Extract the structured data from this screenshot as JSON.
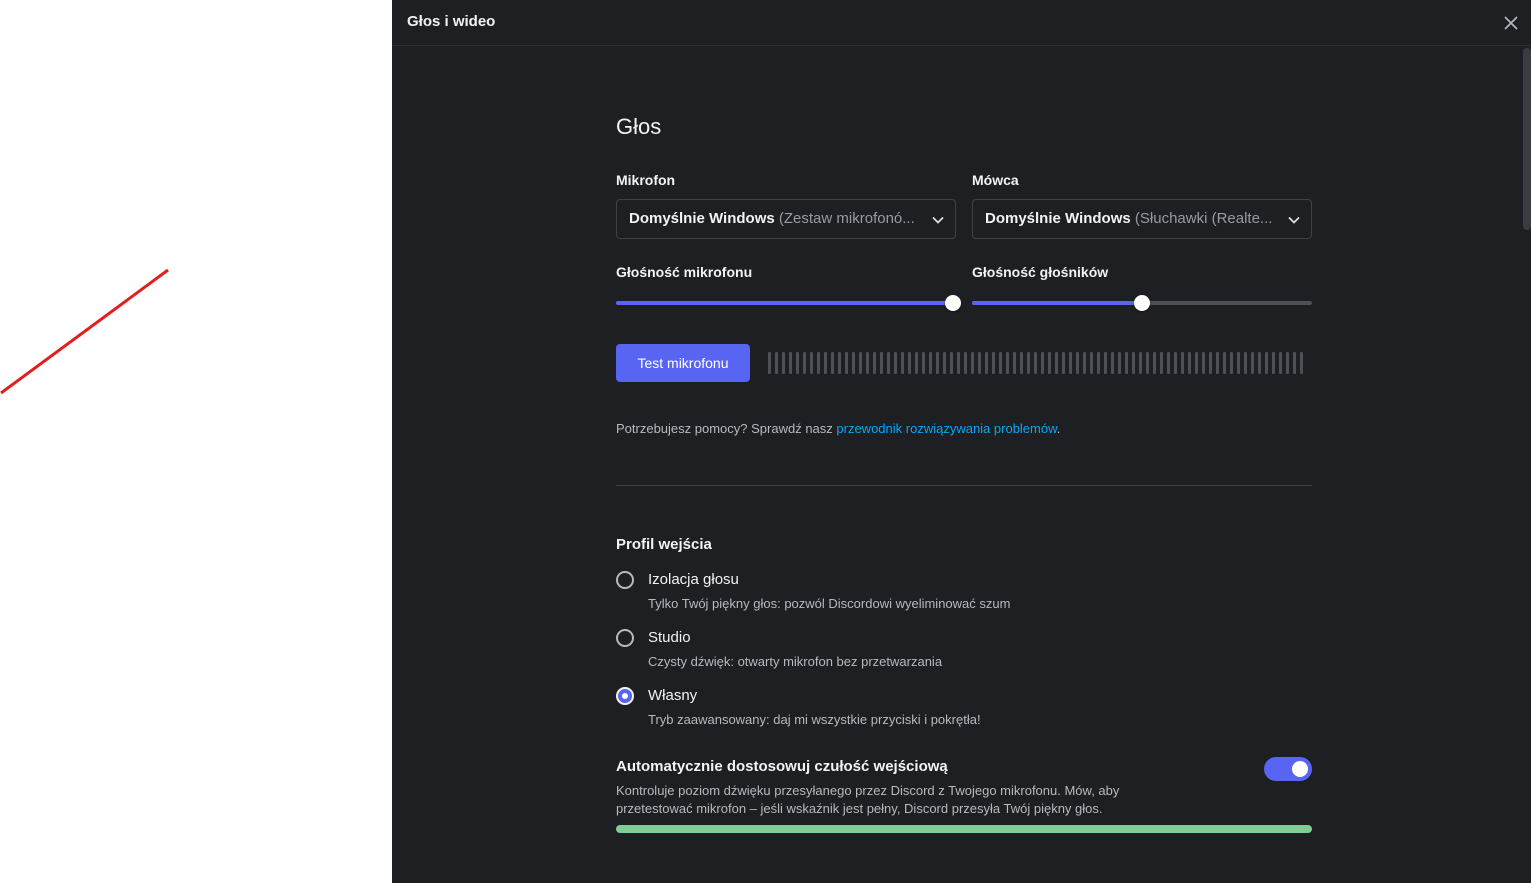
{
  "window": {
    "title": "Głos i wideo"
  },
  "section": {
    "title": "Głos"
  },
  "microphone": {
    "label": "Mikrofon",
    "device_main": "Domyślnie Windows",
    "device_sub": "(Zestaw mikrofonó..."
  },
  "speaker": {
    "label": "Mówca",
    "device_main": "Domyślnie Windows",
    "device_sub": "(Słuchawki (Realte..."
  },
  "mic_volume": {
    "label": "Głośność mikrofonu",
    "value_percent": 99
  },
  "speaker_volume": {
    "label": "Głośność głośników",
    "value_percent": 50
  },
  "test_button": {
    "label": "Test mikrofonu"
  },
  "help": {
    "prefix": "Potrzebujesz pomocy? Sprawdź nasz ",
    "link": "przewodnik rozwiązywania problemów",
    "suffix": "."
  },
  "input_profile": {
    "title": "Profil wejścia",
    "options": [
      {
        "label": "Izolacja głosu",
        "description": "Tylko Twój piękny głos: pozwól Discordowi wyeliminować szum",
        "selected": false
      },
      {
        "label": "Studio",
        "description": "Czysty dźwięk: otwarty mikrofon bez przetwarzania",
        "selected": false
      },
      {
        "label": "Własny",
        "description": "Tryb zaawansowany: daj mi wszystkie przyciski i pokrętła!",
        "selected": true
      }
    ]
  },
  "auto_sensitivity": {
    "title": "Automatycznie dostosowuj czułość wejściową",
    "description": "Kontroluje poziom dźwięku przesyłanego przez Discord z Twojego mikrofonu. Mów, aby przetestować mikrofon – jeśli wskaźnik jest pełny, Discord przesyła Twój piękny głos.",
    "enabled": true
  },
  "colors": {
    "accent": "#5865f2",
    "link": "#00a8fc",
    "meter_green": "#80cd96",
    "background": "#1e1f22"
  }
}
